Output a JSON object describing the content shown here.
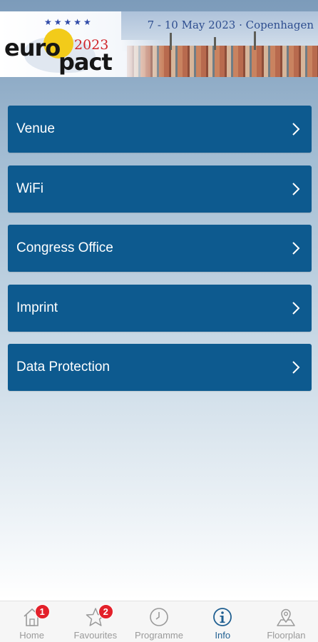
{
  "banner": {
    "logo_euro": "euro",
    "logo_pact": "pact",
    "logo_year": "2023",
    "logo_stars": "★★★★★",
    "date_location": "7 - 10 May 2023 · Copenhagen"
  },
  "menu": {
    "items": [
      {
        "label": "Venue",
        "icon": "chevron-right-icon"
      },
      {
        "label": "WiFi",
        "icon": "chevron-right-icon"
      },
      {
        "label": "Congress Office",
        "icon": "chevron-right-icon"
      },
      {
        "label": "Imprint",
        "icon": "chevron-right-icon"
      },
      {
        "label": "Data Protection",
        "icon": "chevron-right-icon"
      }
    ]
  },
  "tabbar": {
    "tabs": [
      {
        "label": "Home",
        "icon": "home-icon",
        "badge": "1",
        "active": false
      },
      {
        "label": "Favourites",
        "icon": "star-icon",
        "badge": "2",
        "active": false
      },
      {
        "label": "Programme",
        "icon": "clock-icon",
        "active": false
      },
      {
        "label": "Info",
        "icon": "info-icon",
        "active": true
      },
      {
        "label": "Floorplan",
        "icon": "map-pin-icon",
        "active": false
      }
    ]
  },
  "colors": {
    "menu_item_bg": "#0d5a8f",
    "active_tab": "#1f5f91",
    "inactive_tab": "#9a9a9a",
    "badge": "#e3202a"
  }
}
